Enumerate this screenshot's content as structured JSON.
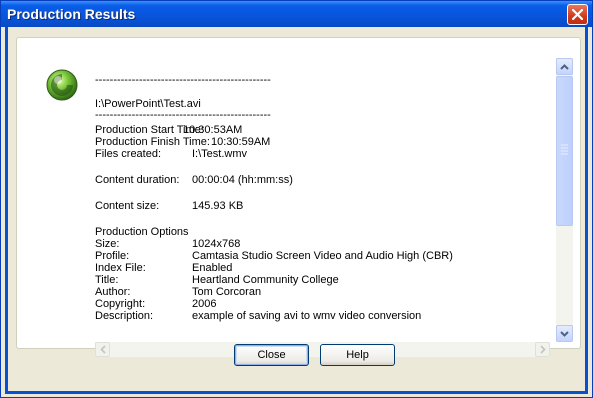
{
  "window": {
    "title": "Production Results"
  },
  "content": {
    "separator": "------------------------------------------------",
    "file_path": "I:\\PowerPoint\\Test.avi",
    "timing": [
      {
        "label": "Production Start Time:",
        "value": "10:30:53AM"
      },
      {
        "label": "Production Finish Time:",
        "value": "10:30:59AM"
      },
      {
        "label": "Files created:",
        "value": "I:\\Test.wmv"
      }
    ],
    "duration": {
      "label": "Content duration:",
      "value": "00:00:04 (hh:mm:ss)"
    },
    "size": {
      "label": "Content size:",
      "value": "145.93 KB"
    },
    "options_heading": "Production Options",
    "options": [
      {
        "label": "Size:",
        "value": "1024x768"
      },
      {
        "label": "Profile:",
        "value": "Camtasia Studio Screen Video and Audio High (CBR)"
      },
      {
        "label": "Index File:",
        "value": "Enabled"
      },
      {
        "label": "Title:",
        "value": "Heartland Community College"
      },
      {
        "label": "Author:",
        "value": "Tom Corcoran"
      },
      {
        "label": "Copyright:",
        "value": "2006"
      },
      {
        "label": "Description:",
        "value": "example of saving avi to wmv video conversion"
      }
    ]
  },
  "buttons": {
    "close": "Close",
    "help": "Help"
  },
  "icons": {
    "app": "camtasia-orb-icon",
    "close": "close-icon",
    "scroll_up": "chevron-up-icon",
    "scroll_down": "chevron-down-icon",
    "scroll_left": "chevron-left-icon",
    "scroll_right": "chevron-right-icon"
  },
  "colors": {
    "titlebar": "#0855dd",
    "close_button": "#d1391a",
    "dialog_bg": "#ece9d8"
  }
}
